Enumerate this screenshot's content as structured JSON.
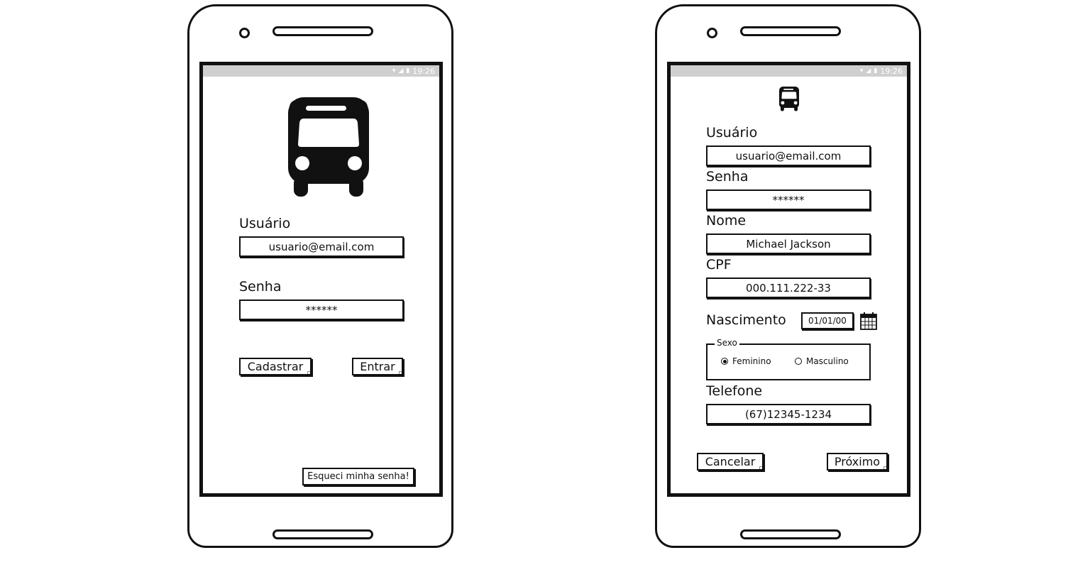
{
  "status_time": "19:26",
  "login": {
    "usuario_label": "Usuário",
    "usuario_value": "usuario@email.com",
    "senha_label": "Senha",
    "senha_value": "******",
    "cadastrar_label": "Cadastrar",
    "entrar_label": "Entrar",
    "esqueci_label": "Esqueci minha senha!"
  },
  "register": {
    "usuario_label": "Usuário",
    "usuario_value": "usuario@email.com",
    "senha_label": "Senha",
    "senha_value": "******",
    "nome_label": "Nome",
    "nome_value": "Michael Jackson",
    "cpf_label": "CPF",
    "cpf_value": "000.111.222-33",
    "nascimento_label": "Nascimento",
    "nascimento_value": "01/01/00",
    "sexo_legend": "Sexo",
    "sexo_options": [
      "Feminino",
      "Masculino"
    ],
    "sexo_selected": "Feminino",
    "telefone_label": "Telefone",
    "telefone_value": "(67)12345-1234",
    "cancelar_label": "Cancelar",
    "proximo_label": "Próximo"
  },
  "icons": [
    "bus-icon",
    "wifi-icon",
    "signal-icon",
    "battery-icon",
    "calendar-icon"
  ]
}
